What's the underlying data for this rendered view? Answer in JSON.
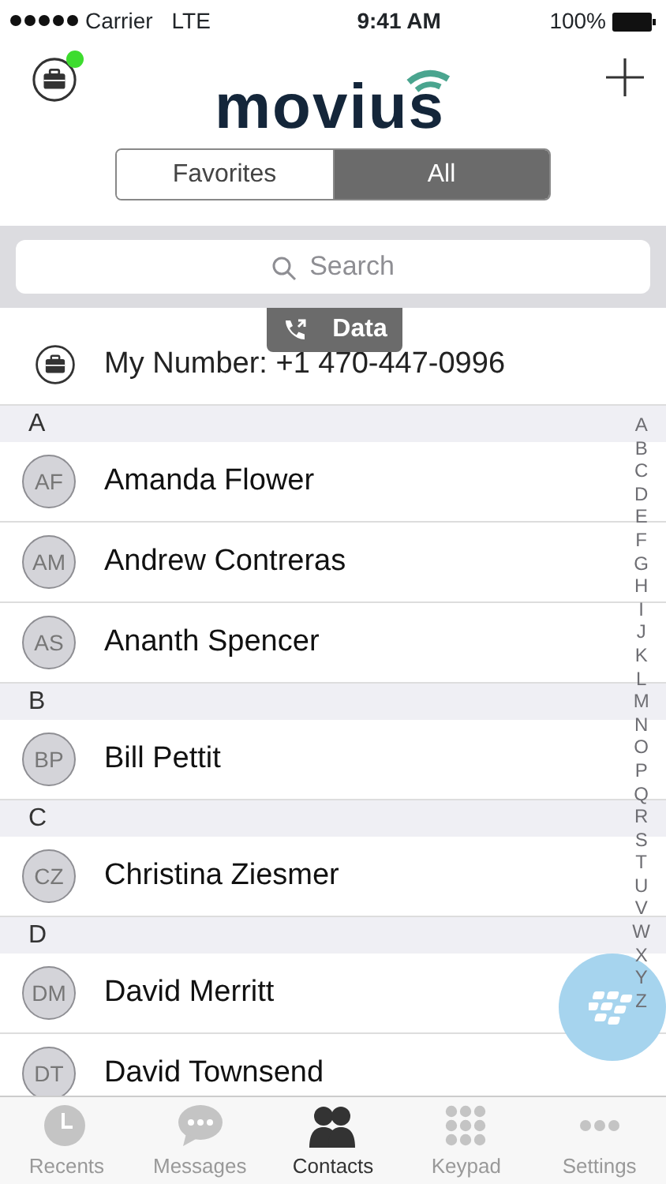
{
  "status_bar": {
    "carrier": "Carrier",
    "network": "LTE",
    "time": "9:41 AM",
    "battery": "100%"
  },
  "header": {
    "logo": "movius",
    "online": true
  },
  "segments": [
    {
      "label": "Favorites",
      "selected": false
    },
    {
      "label": "All",
      "selected": true
    }
  ],
  "search": {
    "placeholder": "Search"
  },
  "data_badge": "Data",
  "my_number": "My Number: +1 470-447-0996",
  "sections": [
    {
      "letter": "A",
      "contacts": [
        {
          "initials": "AF",
          "name": "Amanda Flower"
        },
        {
          "initials": "AM",
          "name": "Andrew Contreras"
        },
        {
          "initials": "AS",
          "name": "Ananth Spencer"
        }
      ]
    },
    {
      "letter": "B",
      "contacts": [
        {
          "initials": "BP",
          "name": "Bill Pettit"
        }
      ]
    },
    {
      "letter": "C",
      "contacts": [
        {
          "initials": "CZ",
          "name": "Christina Ziesmer"
        }
      ]
    },
    {
      "letter": "D",
      "contacts": [
        {
          "initials": "DM",
          "name": "David Merritt"
        },
        {
          "initials": "DT",
          "name": "David Townsend"
        }
      ]
    }
  ],
  "index": [
    "A",
    "B",
    "C",
    "D",
    "E",
    "F",
    "G",
    "H",
    "I",
    "J",
    "K",
    "L",
    "M",
    "N",
    "O",
    "P",
    "Q",
    "R",
    "S",
    "T",
    "U",
    "V",
    "W",
    "X",
    "Y",
    "Z"
  ],
  "tab_bar": [
    {
      "kind": "clock",
      "label": "Recents",
      "selected": false
    },
    {
      "kind": "bubble",
      "label": "Messages",
      "selected": false
    },
    {
      "kind": "people",
      "label": "Contacts",
      "selected": true
    },
    {
      "kind": "keypad",
      "label": "Keypad",
      "selected": false
    },
    {
      "kind": "dots",
      "label": "Settings",
      "selected": false
    }
  ]
}
